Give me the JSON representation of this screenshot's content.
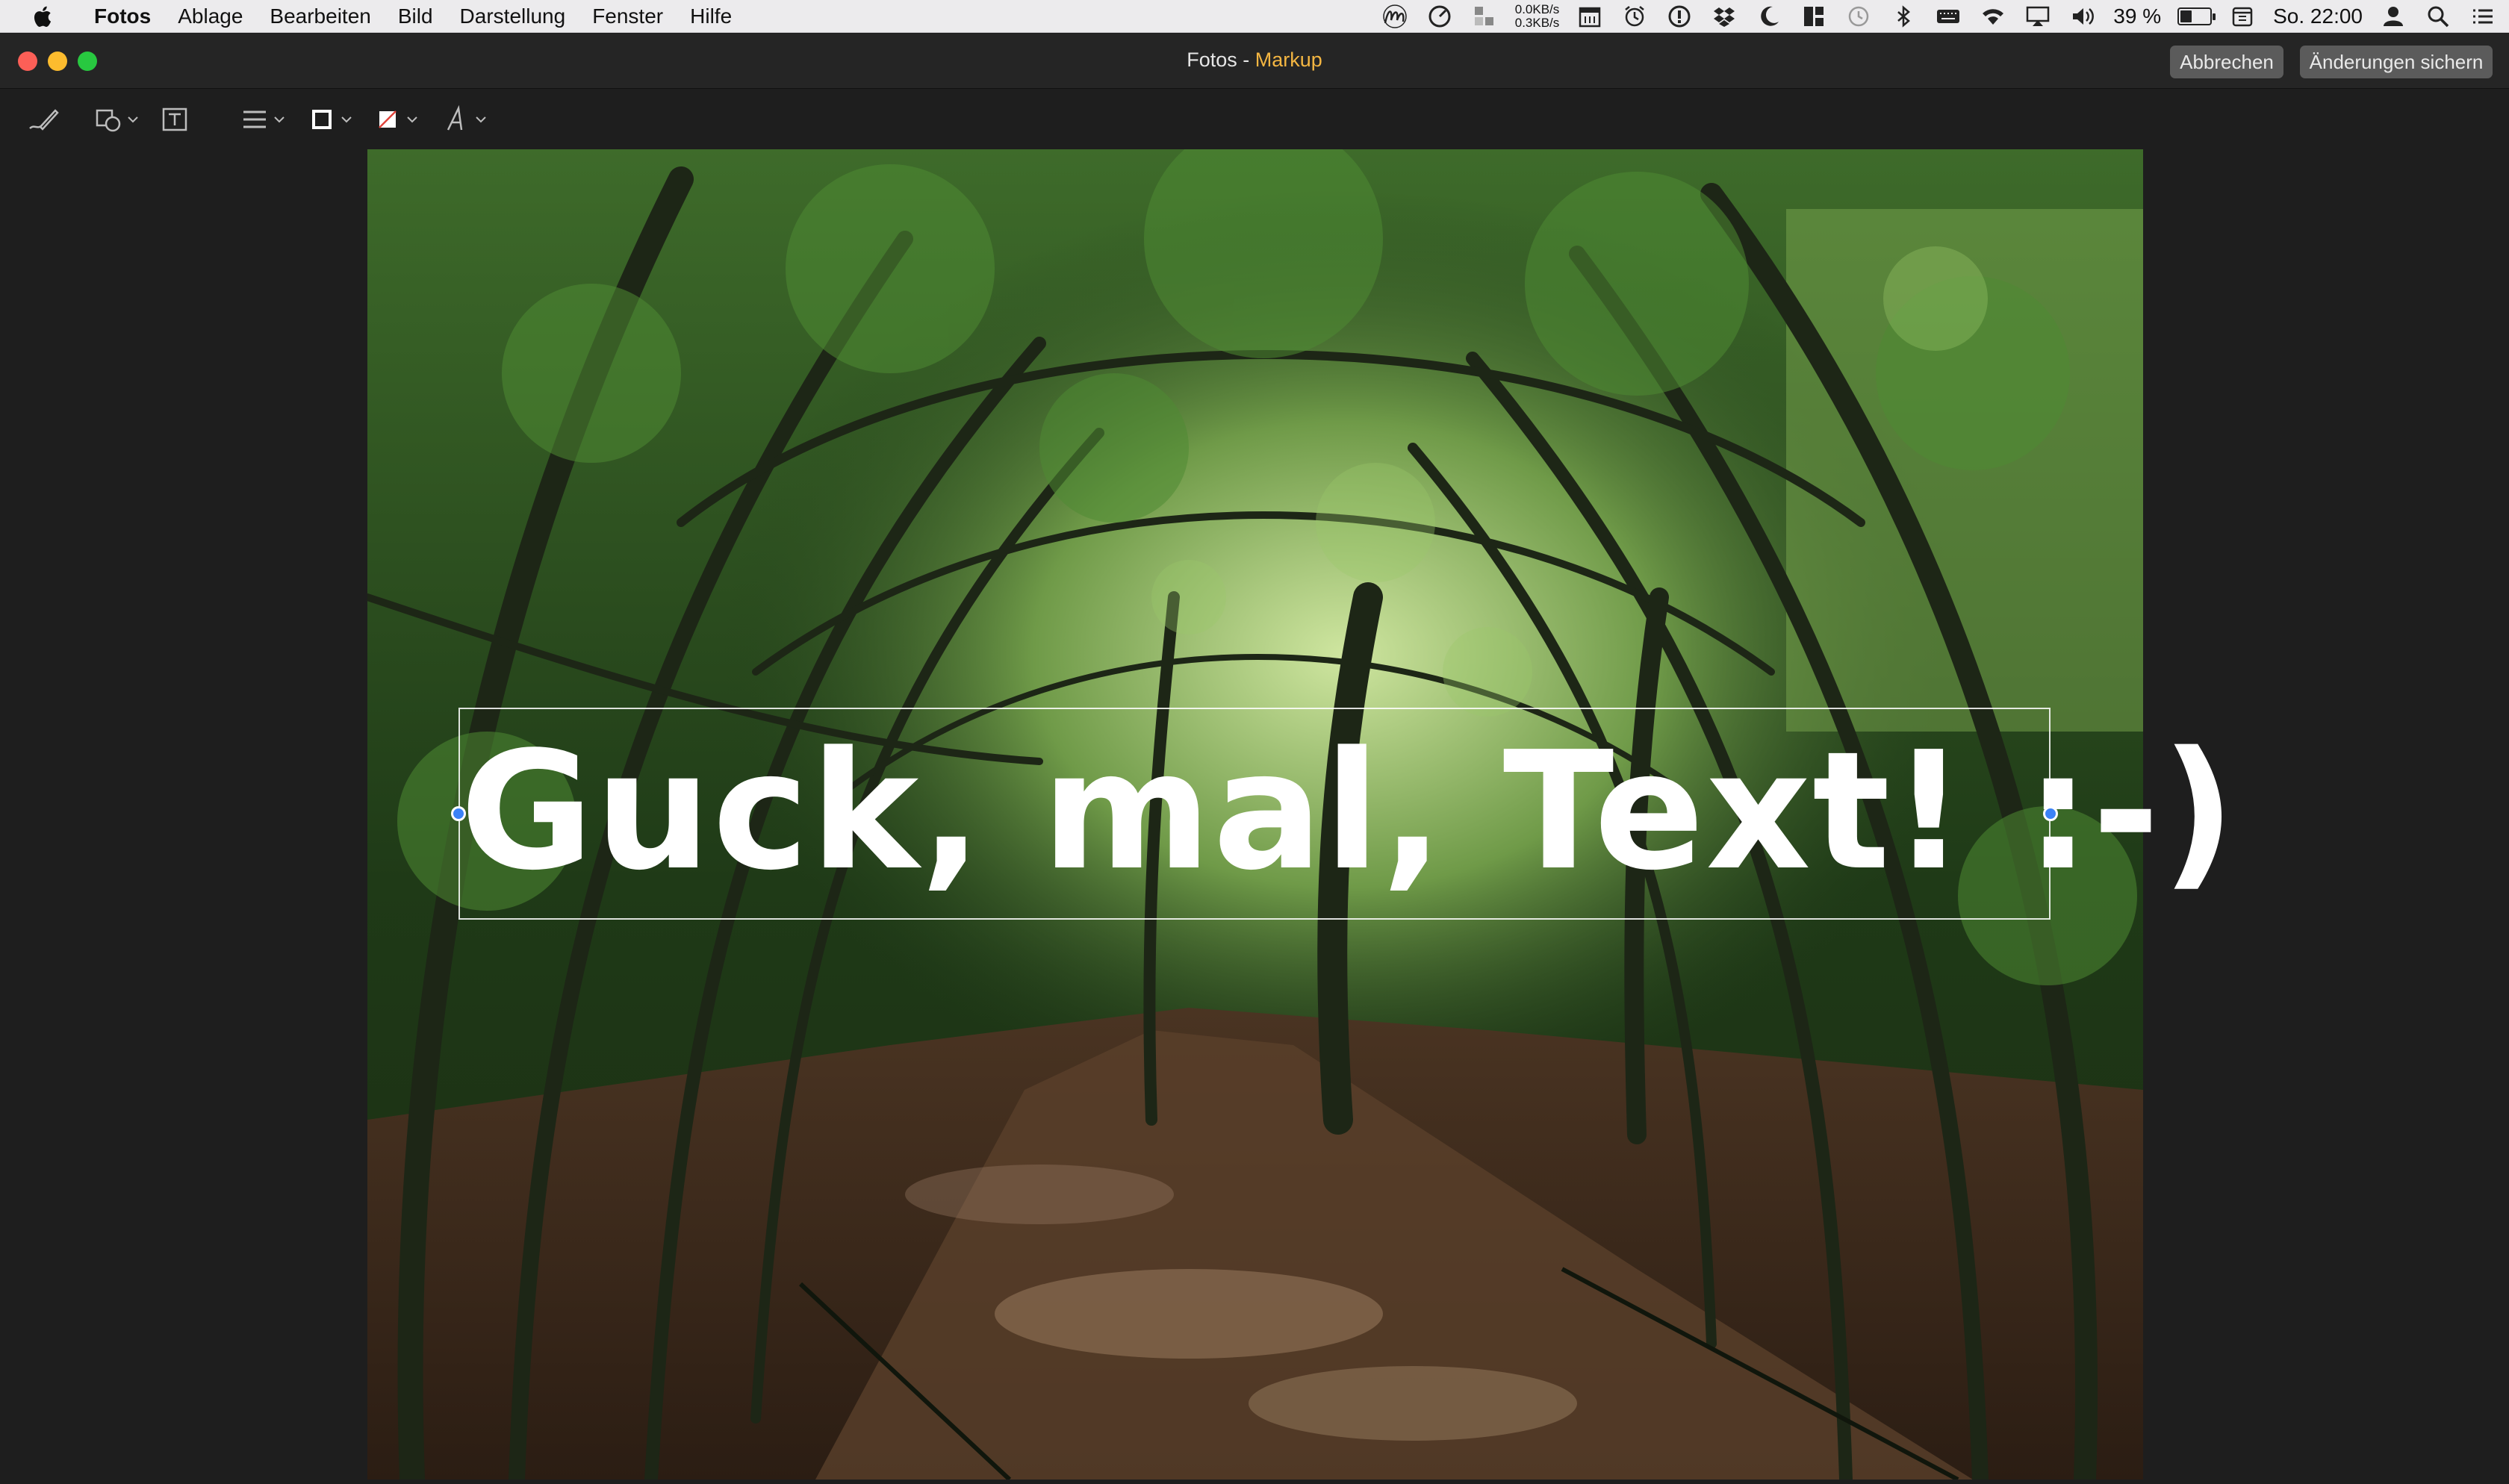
{
  "menubar": {
    "app_name": "Fotos",
    "items": [
      "Ablage",
      "Bearbeiten",
      "Bild",
      "Darstellung",
      "Fenster",
      "Hilfe"
    ],
    "network": {
      "down": "0.0KB/s",
      "up": "0.3KB/s"
    },
    "battery_percent": "39 %",
    "battery_level": 0.39,
    "clock": "So. 22:00",
    "tray_icons": [
      "scribble-icon",
      "activity-icon",
      "language-icon",
      "calendar-icon",
      "alarm-icon",
      "info-circle-icon",
      "dropbox-icon",
      "moon-icon",
      "grid-icon",
      "time-machine-icon",
      "bluetooth-icon",
      "keyboard-icon",
      "wifi-icon",
      "airplay-icon",
      "volume-icon",
      "date-icon",
      "user-icon",
      "spotlight-icon",
      "list-icon"
    ]
  },
  "window": {
    "title_app": "Fotos",
    "title_separator": " - ",
    "title_mode": "Markup",
    "cancel_label": "Abbrechen",
    "save_label": "Änderungen sichern"
  },
  "toolbar": {
    "tools": [
      "sketch-tool",
      "shapes-tool",
      "text-tool",
      "line-style-tool",
      "border-color-tool",
      "fill-color-tool",
      "text-style-tool"
    ]
  },
  "annotation": {
    "text": "Guck, mal, Text! :-)",
    "color": "#ffffff"
  },
  "colors": {
    "title_mode": "#f4b642",
    "close": "#fc5f57",
    "minimize": "#fdbc2e",
    "maximize": "#28c840",
    "handle": "#3b82f6"
  }
}
